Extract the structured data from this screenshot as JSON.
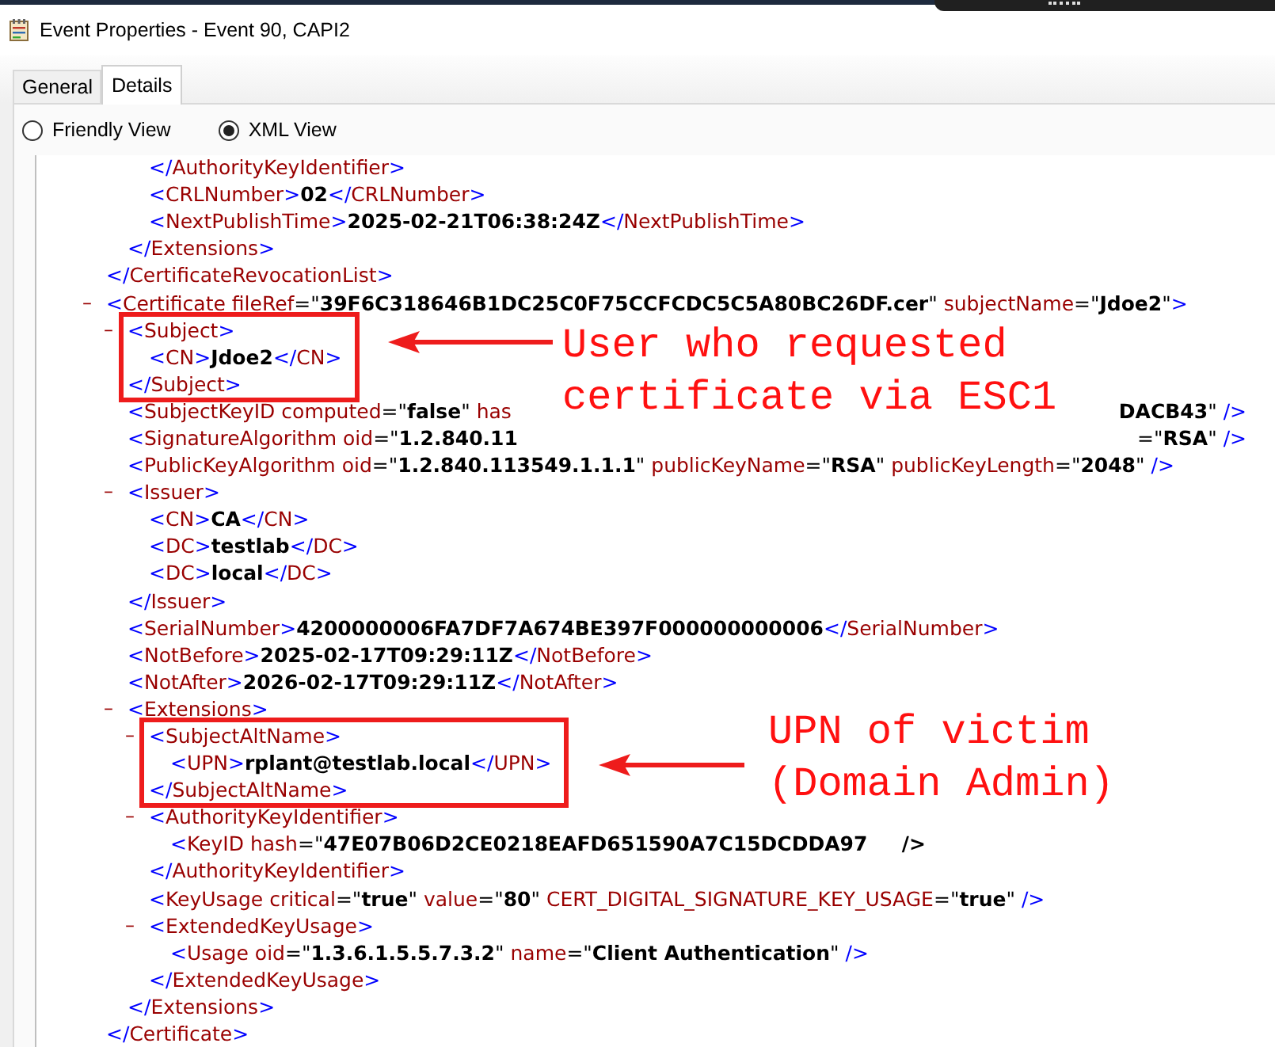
{
  "window": {
    "title": "Event Properties - Event 90, CAPI2"
  },
  "tabs": [
    {
      "label": "General",
      "selected": false
    },
    {
      "label": "Details",
      "selected": true
    }
  ],
  "view_options": [
    {
      "label": "Friendly View",
      "selected": false
    },
    {
      "label": "XML View",
      "selected": true
    }
  ],
  "xml": [
    {
      "boxed": false,
      "children": [
        {
          "boxed": false,
          "children": [
            {
              "line": "</AuthorityKeyIdentifier>"
            },
            {
              "line": "<CRLNumber>02</CRLNumber>"
            },
            {
              "line": "<NextPublishTime>2025-02-21T06:38:24Z</NextPublishTime>"
            }
          ],
          "close": "</Extensions>"
        }
      ],
      "close": "</CertificateRevocationList>"
    },
    {
      "toggle": "–",
      "boxed": false,
      "open": "<Certificate fileRef=\"39F6C318646B1DC25C0F75CCFCDC5C5A80BC26DF.cer\" subjectName=\"Jdoe2\">",
      "children": [
        {
          "toggle": "–",
          "boxed": true,
          "open": "<Subject>",
          "children": [
            {
              "line": "<CN>Jdoe2</CN>"
            }
          ],
          "close": "</Subject>"
        },
        {
          "line": "<SubjectKeyID computed=\"false\" has",
          "tail": "DACB43\" />"
        },
        {
          "line": "<SignatureAlgorithm oid=\"1.2.840.11",
          "tail": "=\"RSA\" />"
        },
        {
          "line": "<PublicKeyAlgorithm oid=\"1.2.840.113549.1.1.1\" publicKeyName=\"RSA\" publicKeyLength=\"2048\" />"
        },
        {
          "toggle": "–",
          "boxed": false,
          "open": "<Issuer>",
          "children": [
            {
              "line": "<CN>CA</CN>"
            },
            {
              "line": "<DC>testlab</DC>"
            },
            {
              "line": "<DC>local</DC>"
            }
          ],
          "close": "</Issuer>"
        },
        {
          "line": "<SerialNumber>4200000006FA7DF7A674BE397F000000000006</SerialNumber>"
        },
        {
          "line": "<NotBefore>2025-02-17T09:29:11Z</NotBefore>"
        },
        {
          "line": "<NotAfter>2026-02-17T09:29:11Z</NotAfter>"
        },
        {
          "toggle": "–",
          "boxed": false,
          "open": "<Extensions>",
          "children": [
            {
              "toggle": "–",
              "boxed": true,
              "open": "<SubjectAltName>",
              "children": [
                {
                  "line": "<UPN>rplant@testlab.local</UPN>"
                }
              ],
              "close": "</SubjectAltName>"
            },
            {
              "toggle": "–",
              "boxed": false,
              "open": "<AuthorityKeyIdentifier>",
              "children": [
                {
                  "line": "<KeyID hash=\"47E07B06D2CE0218EAFD651590A7C15DCDDA97     />"
                }
              ],
              "close": "</AuthorityKeyIdentifier>"
            },
            {
              "line": "<KeyUsage critical=\"true\" value=\"80\" CERT_DIGITAL_SIGNATURE_KEY_USAGE=\"true\" />"
            },
            {
              "toggle": "–",
              "boxed": false,
              "open": "<ExtendedKeyUsage>",
              "children": [
                {
                  "line": "<Usage oid=\"1.3.6.1.5.5.7.3.2\" name=\"Client Authentication\" />"
                }
              ],
              "close": "</ExtendedKeyUsage>"
            }
          ],
          "close": "</Extensions>"
        }
      ],
      "close": "</Certificate>"
    }
  ],
  "annotations": [
    {
      "lines": [
        "User who requested",
        "certificate via ESC1"
      ]
    },
    {
      "lines": [
        "UPN of victim",
        "(Domain Admin)"
      ]
    }
  ]
}
